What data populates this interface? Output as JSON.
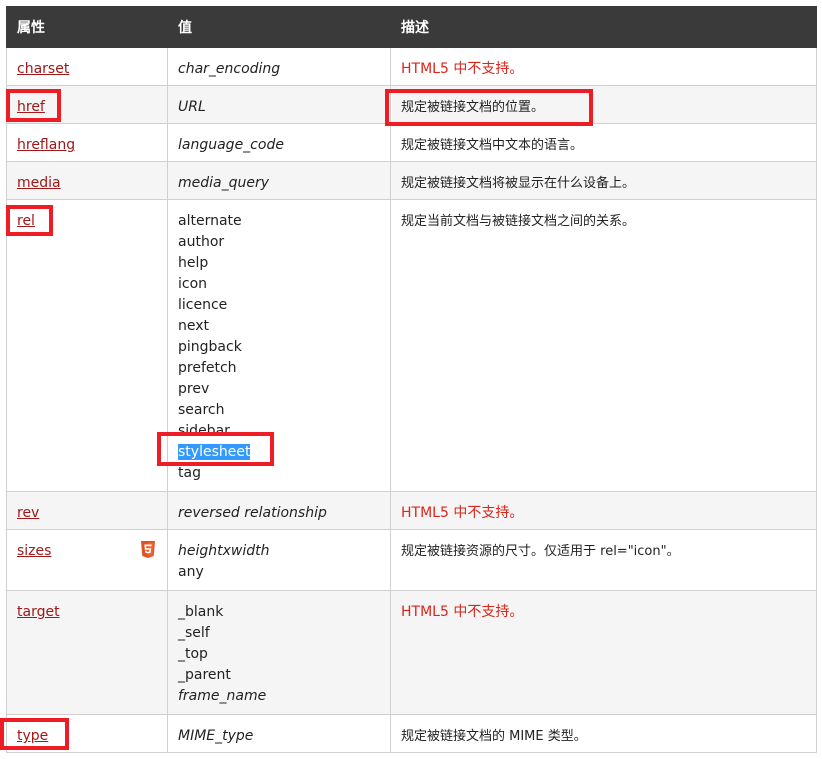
{
  "headers": {
    "attr": "属性",
    "value": "值",
    "desc": "描述"
  },
  "rows": [
    {
      "name": "charset",
      "values": [
        "char_encoding"
      ],
      "desc": "HTML5 中不支持。"
    },
    {
      "name": "href",
      "values": [
        "URL"
      ],
      "desc": "规定被链接文档的位置。"
    },
    {
      "name": "hreflang",
      "values": [
        "language_code"
      ],
      "desc": "规定被链接文档中文本的语言。"
    },
    {
      "name": "media",
      "values": [
        "media_query"
      ],
      "desc": "规定被链接文档将被显示在什么设备上。"
    },
    {
      "name": "rel",
      "values": [
        "alternate",
        "author",
        "help",
        "icon",
        "licence",
        "next",
        "pingback",
        "prefetch",
        "prev",
        "search",
        "sidebar",
        "stylesheet",
        "tag"
      ],
      "desc": "规定当前文档与被链接文档之间的关系。"
    },
    {
      "name": "rev",
      "values": [
        "reversed relationship"
      ],
      "desc": "HTML5 中不支持。"
    },
    {
      "name": "sizes",
      "values": [
        "heightxwidth",
        "any"
      ],
      "desc": "规定被链接资源的尺寸。仅适用于 rel=\"icon\"。",
      "badge": "html5-icon"
    },
    {
      "name": "target",
      "values": [
        "_blank",
        "_self",
        "_top",
        "_parent",
        "frame_name"
      ],
      "desc": "HTML5 中不支持。"
    },
    {
      "name": "type",
      "values": [
        "MIME_type"
      ],
      "desc": "规定被链接文档的 MIME 类型。"
    }
  ],
  "colors": {
    "header_bg": "#3a3a3a",
    "link": "#a01818",
    "unsupported": "#d9261c",
    "annotation": "#ee1c24",
    "selection": "#3399ff"
  }
}
